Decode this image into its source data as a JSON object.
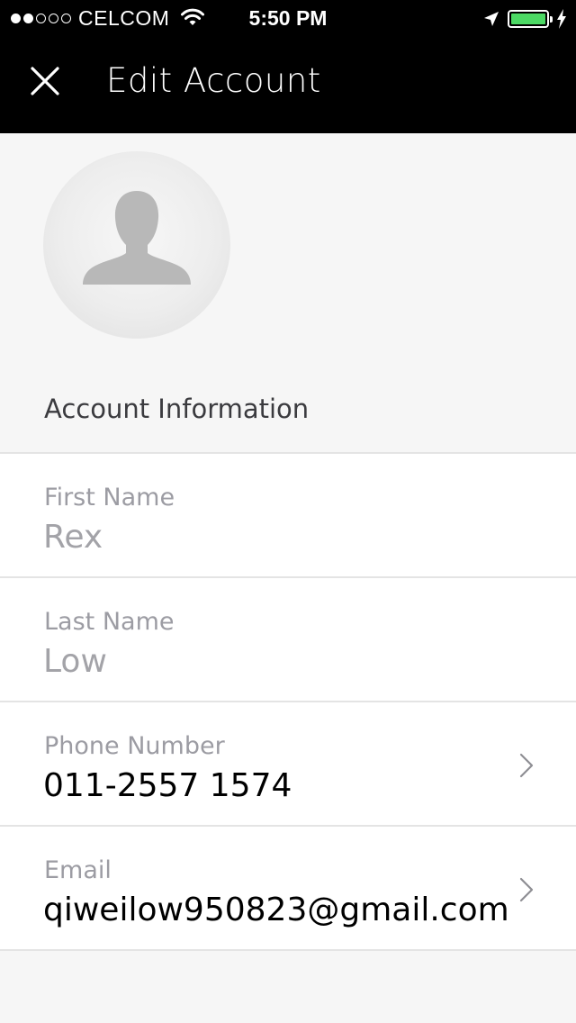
{
  "status_bar": {
    "carrier": "CELCOM",
    "signal_filled": 2,
    "signal_total": 5,
    "time": "5:50 PM",
    "battery_level": 1.0,
    "battery_color": "#4cd964"
  },
  "nav": {
    "title": "Edit Account",
    "close_icon": "close-icon"
  },
  "avatar": {
    "icon": "person-silhouette-icon"
  },
  "account_info": {
    "section_title": "Account Information",
    "fields": [
      {
        "label": "First Name",
        "value": "Rex",
        "editable_chevron": false
      },
      {
        "label": "Last Name",
        "value": "Low",
        "editable_chevron": false
      },
      {
        "label": "Phone Number",
        "value": "011-2557 1574",
        "editable_chevron": true
      },
      {
        "label": "Email",
        "value": "qiweilow950823@gmail.com",
        "editable_chevron": true
      }
    ]
  }
}
